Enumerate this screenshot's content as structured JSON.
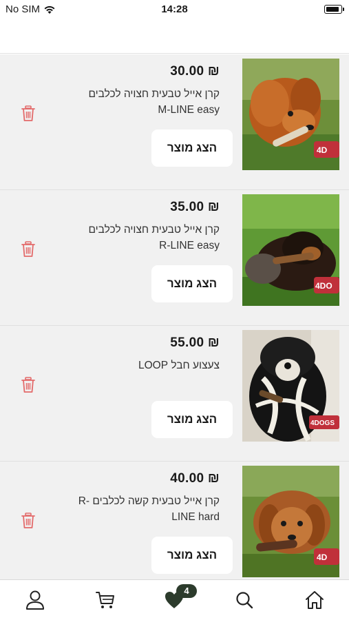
{
  "status_bar": {
    "carrier": "No SIM",
    "time": "14:28"
  },
  "products": [
    {
      "price": "₪ 30.00",
      "name": "קרן אייל טבעית חצויה לכלבים M-LINE easy",
      "button": "הצג מוצר",
      "image": "dog-chewing-antler",
      "image_badge": "4D"
    },
    {
      "price": "₪ 35.00",
      "name": "קרן אייל טבעית חצויה לכלבים R-LINE easy",
      "button": "הצג מוצר",
      "image": "dog-playing-antler",
      "image_badge": "4DO"
    },
    {
      "price": "₪ 55.00",
      "name": "צעצוע חבל LOOP",
      "button": "הצג מוצר",
      "image": "dog-rope-toy",
      "image_badge": "4DOGS"
    },
    {
      "price": "₪ 40.00",
      "name": "קרן אייל טבעית קשה לכלבים R-LINE hard",
      "button": "הצג מוצר",
      "image": "dog-lying-antler",
      "image_badge": "4D"
    }
  ],
  "bottom_nav": {
    "items": [
      "profile-icon",
      "cart-icon",
      "heart-icon",
      "search-icon",
      "home-icon"
    ],
    "wishlist_count": "4"
  },
  "colors": {
    "trash": "#e36a6a",
    "badge": "#2c3b2c",
    "image_badge": "#c0303a"
  }
}
